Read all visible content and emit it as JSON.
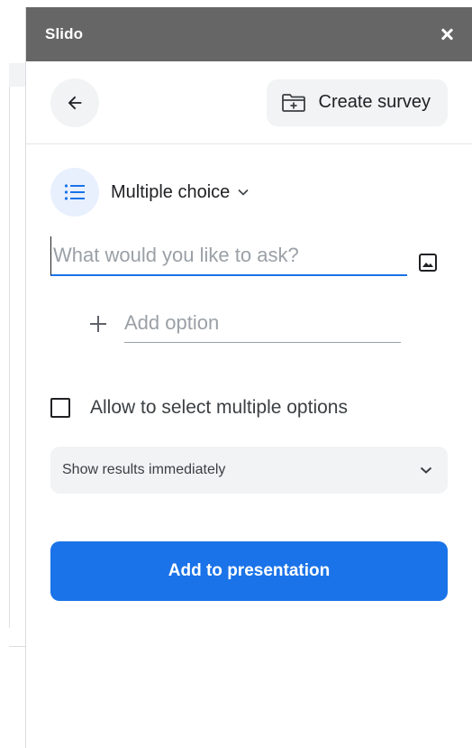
{
  "panel": {
    "title": "Slido"
  },
  "toolbar": {
    "create_survey_label": "Create survey"
  },
  "question_type": {
    "label": "Multiple choice"
  },
  "question": {
    "value": "",
    "placeholder": "What would you like to ask?"
  },
  "option": {
    "value": "",
    "placeholder": "Add option"
  },
  "multi_select": {
    "label": "Allow to select multiple options",
    "checked": false
  },
  "results": {
    "selected": "Show results immediately"
  },
  "actions": {
    "add_label": "Add to presentation"
  },
  "colors": {
    "titlebar": "#666666",
    "accent": "#1a73e8",
    "chip_bg": "#f1f3f4"
  },
  "icons": {
    "back": "arrow-left-icon",
    "create_survey": "folder-plus-icon",
    "question_type": "list-icon",
    "chevron": "chevron-down-icon",
    "image": "image-icon",
    "add_option": "plus-icon",
    "close": "close-icon"
  }
}
